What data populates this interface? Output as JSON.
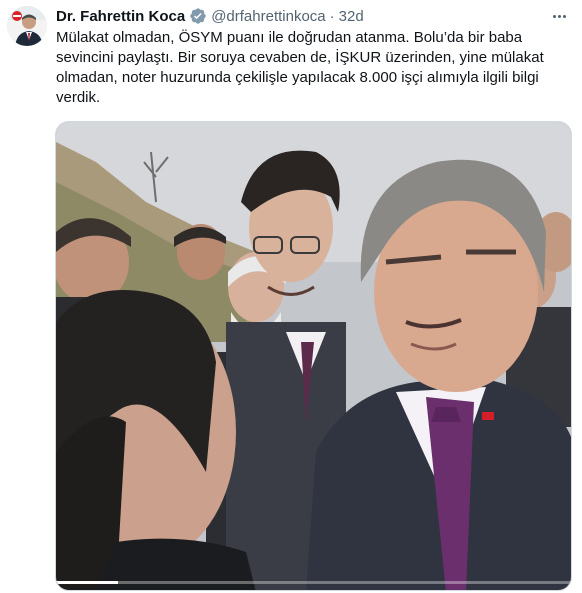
{
  "author": {
    "display_name": "Dr. Fahrettin Koca",
    "handle": "@drfahrettinkoca",
    "separator": "·",
    "timestamp": "32d",
    "verified": true,
    "verified_color": "#829aab",
    "avatar_icon": "profile-photo"
  },
  "more_icon": "more-horizontal-icon",
  "tweet": {
    "lines": [
      "Mülakat olmadan, ÖSYM puanı ile doğrudan atanma. Bolu’da bir baba",
      "sevincini paylaştı. Bir soruya cevaben de, İŞKUR üzerinden, yine mülakat",
      "olmadan, noter huzurunda çekilişle yapılacak 8.000 işçi alımıyla ilgili bilgi",
      "verdik."
    ]
  },
  "media": {
    "type": "video",
    "progress": 0.12
  },
  "colors": {
    "text_primary": "#0f1419",
    "text_secondary": "#536471",
    "border": "#cfd9de"
  }
}
